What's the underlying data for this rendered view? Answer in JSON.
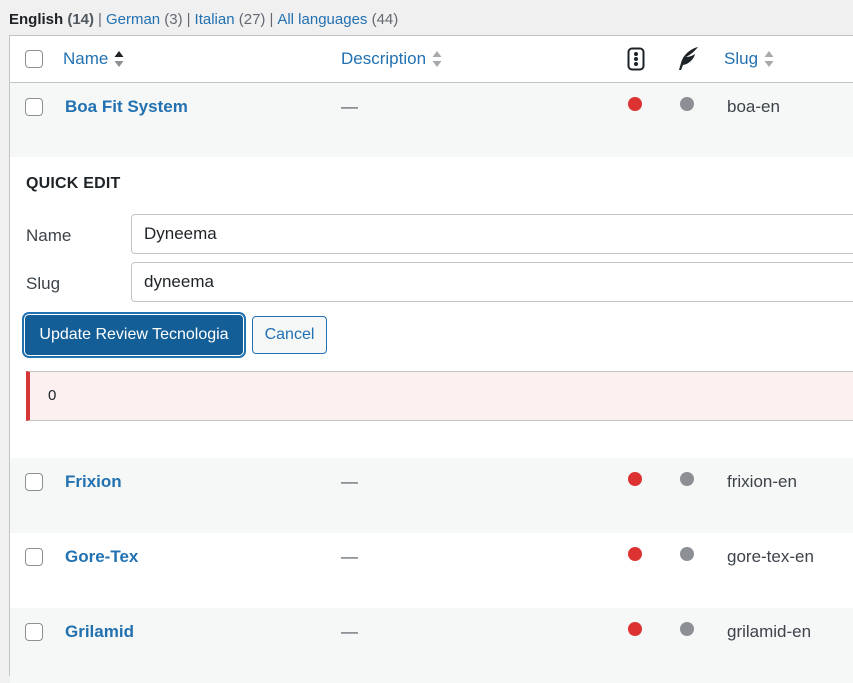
{
  "languages": [
    {
      "label": "English",
      "count": "(14)",
      "current": true
    },
    {
      "label": "German",
      "count": "(3)",
      "current": false
    },
    {
      "label": "Italian",
      "count": "(27)",
      "current": false
    },
    {
      "label": "All languages",
      "count": "(44)",
      "current": false
    }
  ],
  "separator": "|",
  "columns": {
    "name": "Name",
    "description": "Description",
    "status_icon": "traffic-light-icon",
    "feather_icon": "feather-icon",
    "slug": "Slug"
  },
  "rows": [
    {
      "name": "Boa Fit System",
      "description": "—",
      "status_color": "#dc3232",
      "secondary_color": "#8c8f94",
      "slug": "boa-en"
    },
    {
      "name": "Frixion",
      "description": "—",
      "status_color": "#dc3232",
      "secondary_color": "#8c8f94",
      "slug": "frixion-en"
    },
    {
      "name": "Gore-Tex",
      "description": "—",
      "status_color": "#dc3232",
      "secondary_color": "#8c8f94",
      "slug": "gore-tex-en"
    },
    {
      "name": "Grilamid",
      "description": "—",
      "status_color": "#dc3232",
      "secondary_color": "#8c8f94",
      "slug": "grilamid-en"
    }
  ],
  "quick_edit": {
    "title": "Quick Edit",
    "name_label": "Name",
    "name_value": "Dyneema",
    "slug_label": "Slug",
    "slug_value": "dyneema",
    "update_button": "Update Review Tecnologia",
    "cancel_button": "Cancel",
    "error_message": "0"
  },
  "colors": {
    "link": "#2271b1",
    "primary_button": "#135e96",
    "error_border": "#d63638",
    "error_bg": "#fcf0f1"
  }
}
